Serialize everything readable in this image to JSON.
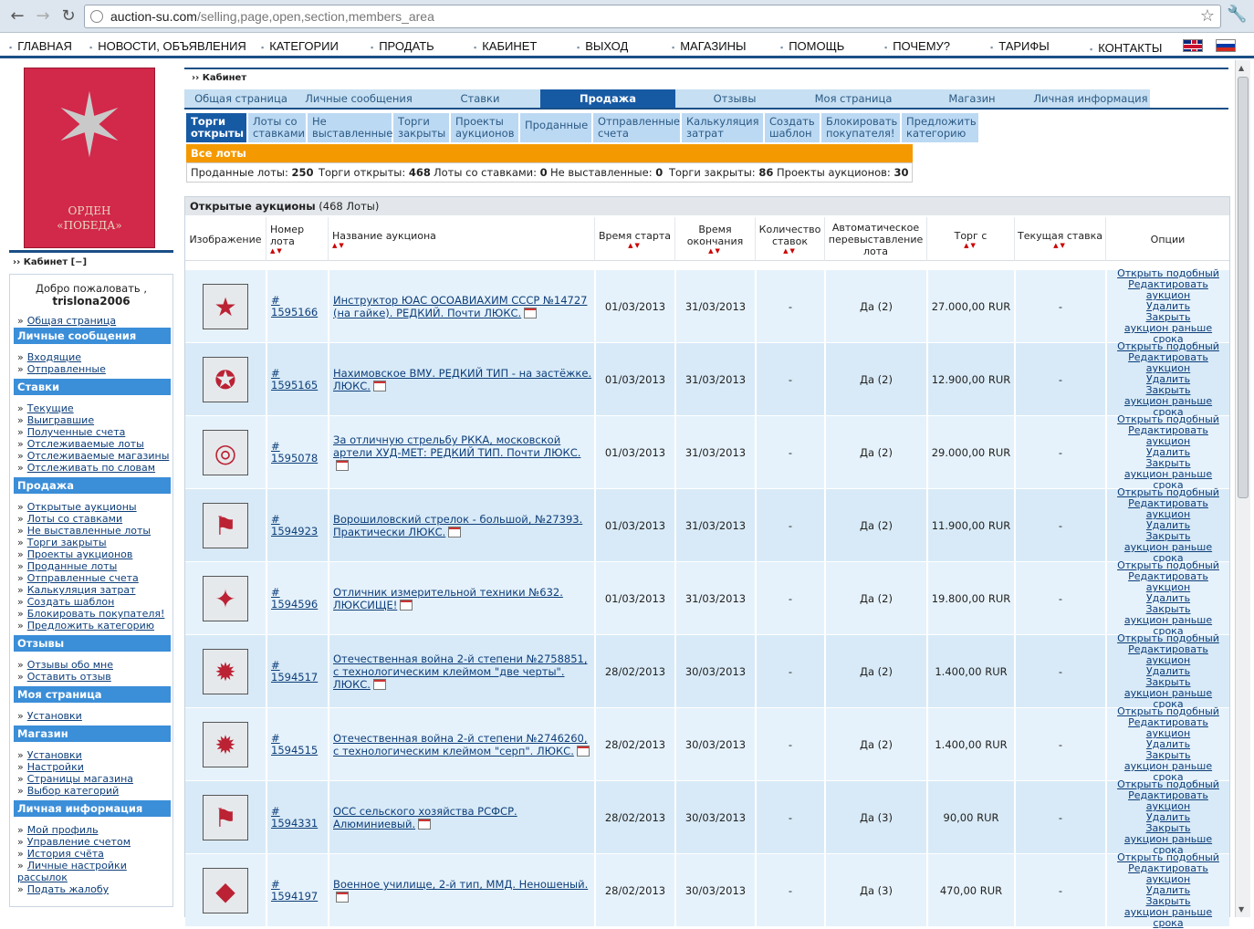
{
  "browser": {
    "url_host": "auction-su.com",
    "url_path": "/selling,page,open,section,members_area",
    "back_icon": "arrow-left-icon",
    "forward_icon": "arrow-right-icon",
    "reload_icon": "reload-icon",
    "star_icon": "star-icon",
    "wrench_icon": "wrench-icon"
  },
  "topnav": [
    "ГЛАВНАЯ",
    "НОВОСТИ, ОБЪЯВЛЕНИЯ",
    "КАТЕГОРИИ",
    "ПРОДАТЬ",
    "КАБИНЕТ",
    "ВЫХОД",
    "МАГАЗИНЫ",
    "ПОМОЩЬ",
    "ПОЧЕМУ?",
    "ТАРИФЫ",
    "КОНТАКТЫ"
  ],
  "sidebar": {
    "cover_line1": "ОРДЕН",
    "cover_line2": "«ПОБЕДА»",
    "header": "›› Кабинет [−]",
    "welcome": "Добро пожаловать ,",
    "username": "trislona2006",
    "home_link": "Общая страница",
    "sections": [
      {
        "title": "Личные сообщения",
        "links": [
          "Входящие",
          "Отправленные"
        ]
      },
      {
        "title": "Ставки",
        "links": [
          "Текущие",
          "Выигравшие",
          "Полученные счета",
          "Отслеживаемые лоты",
          "Отслеживаемые магазины",
          "Отслеживать по словам"
        ]
      },
      {
        "title": "Продажа",
        "links": [
          "Открытые аукционы",
          "Лоты со ставками",
          "Не выставленные лоты",
          "Торги закрыты",
          "Проекты аукционов",
          "Проданные лоты",
          "Отправленные счета",
          "Калькуляция затрат",
          "Создать шаблон",
          "Блокировать покупателя!",
          "Предложить категорию"
        ]
      },
      {
        "title": "Отзывы",
        "links": [
          "Отзывы обо мне",
          "Оставить отзыв"
        ]
      },
      {
        "title": "Моя страница",
        "links": [
          "Установки"
        ]
      },
      {
        "title": "Магазин",
        "links": [
          "Установки",
          "Настройки",
          "Страницы магазина",
          "Выбор категорий"
        ]
      },
      {
        "title": "Личная информация",
        "links": [
          "Мой профиль",
          "Управление счетом",
          "История счёта",
          "Личные настройки рассылок",
          "Подать жалобу"
        ]
      }
    ]
  },
  "main": {
    "breadcrumb": "›› Кабинет",
    "tabs": [
      "Общая страница",
      "Личные сообщения",
      "Ставки",
      "Продажа",
      "Отзывы",
      "Моя страница",
      "Магазин",
      "Личная информация"
    ],
    "active_tab": "Продажа",
    "subtabs": [
      "Торги открыты",
      "Лоты со ставками",
      "Не выставленные",
      "Торги закрыты",
      "Проекты аукционов",
      "Проданные",
      "Отправленные счета",
      "Калькуляция затрат",
      "Создать шаблон",
      "Блокировать покупателя!",
      "Предложить категорию"
    ],
    "all_lots": "Все лоты",
    "stats": [
      {
        "label": "Проданные лоты:",
        "value": "250"
      },
      {
        "label": "Торги открыты:",
        "value": "468"
      },
      {
        "label": "Лоты со ставками:",
        "value": "0"
      },
      {
        "label": "Не выставленные:",
        "value": "0"
      },
      {
        "label": "Торги закрыты:",
        "value": "86"
      },
      {
        "label": "Проекты аукционов:",
        "value": "30"
      }
    ],
    "table_title": "Открытые аукционы",
    "table_count": "(468 Лоты)",
    "columns": [
      "Изображение",
      "Номер лота",
      "Название аукциона",
      "Время старта",
      "Время окончания",
      "Количество ставок",
      "Автоматическое перевыставление лота",
      "Торг с",
      "Текущая ставка",
      "Опции"
    ],
    "options": [
      "Открыть подобный",
      "Редактировать аукцион",
      "Удалить",
      "Закрыть аукцион раньше срока"
    ],
    "rows": [
      {
        "lot": "# 1595166",
        "name": "Инструктор ЮАС ОСОАВИАХИМ СССР №14727 (на гайке). РЕДКИЙ. Почти ЛЮКС.",
        "start": "01/03/2013",
        "end": "31/03/2013",
        "bids": "-",
        "auto": "Да (2)",
        "price": "27.000,00 RUR",
        "current": "-"
      },
      {
        "lot": "# 1595165",
        "name": "Нахимовское ВМУ. РЕДКИЙ ТИП - на застёжке. ЛЮКС.",
        "start": "01/03/2013",
        "end": "31/03/2013",
        "bids": "-",
        "auto": "Да (2)",
        "price": "12.900,00 RUR",
        "current": "-"
      },
      {
        "lot": "# 1595078",
        "name": "За отличную стрельбу РККА, московской артели ХУД-МЕТ: РЕДКИЙ ТИП. Почти ЛЮКС.",
        "start": "01/03/2013",
        "end": "31/03/2013",
        "bids": "-",
        "auto": "Да (2)",
        "price": "29.000,00 RUR",
        "current": "-"
      },
      {
        "lot": "# 1594923",
        "name": "Ворошиловский стрелок - большой, №27393. Практически ЛЮКС.",
        "start": "01/03/2013",
        "end": "31/03/2013",
        "bids": "-",
        "auto": "Да (2)",
        "price": "11.900,00 RUR",
        "current": "-"
      },
      {
        "lot": "# 1594596",
        "name": "Отличник измерительной техники №632. ЛЮКСИЩЕ!",
        "start": "01/03/2013",
        "end": "31/03/2013",
        "bids": "-",
        "auto": "Да (2)",
        "price": "19.800,00 RUR",
        "current": "-"
      },
      {
        "lot": "# 1594517",
        "name": "Отечественная война 2-й степени №2758851, с технологическим клеймом \"две черты\". ЛЮКС.",
        "start": "28/02/2013",
        "end": "30/03/2013",
        "bids": "-",
        "auto": "Да (2)",
        "price": "1.400,00 RUR",
        "current": "-"
      },
      {
        "lot": "# 1594515",
        "name": "Отечественная война 2-й степени №2746260, с технологическим клеймом \"серп\". ЛЮКС.",
        "start": "28/02/2013",
        "end": "30/03/2013",
        "bids": "-",
        "auto": "Да (2)",
        "price": "1.400,00 RUR",
        "current": "-"
      },
      {
        "lot": "# 1594331",
        "name": "ОСС сельского хозяйства РСФСР. Алюминиевый.",
        "start": "28/02/2013",
        "end": "30/03/2013",
        "bids": "-",
        "auto": "Да (3)",
        "price": "90,00 RUR",
        "current": "-"
      },
      {
        "lot": "# 1594197",
        "name": "Военное училище, 2-й тип, ММД. Неношеный.",
        "start": "28/02/2013",
        "end": "30/03/2013",
        "bids": "-",
        "auto": "Да (3)",
        "price": "470,00 RUR",
        "current": "-"
      }
    ]
  }
}
